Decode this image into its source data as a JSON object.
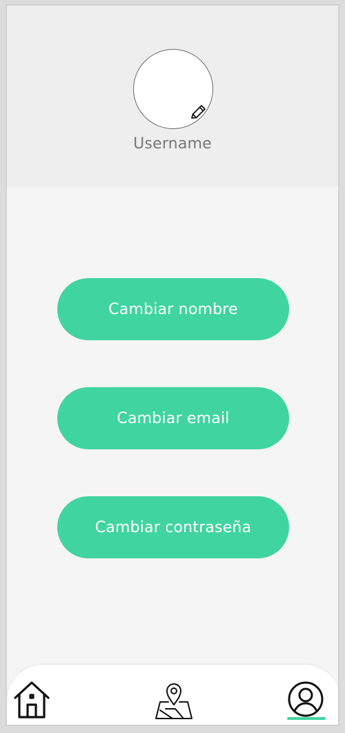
{
  "profile": {
    "username": "Username",
    "avatar_edit_icon": "pencil-icon"
  },
  "actions": {
    "change_name": "Cambiar nombre",
    "change_email": "Cambiar email",
    "change_password": "Cambiar contraseña"
  },
  "nav": {
    "items": [
      {
        "icon": "home-icon"
      },
      {
        "icon": "map-pin-icon"
      },
      {
        "icon": "user-circle-icon"
      }
    ],
    "active_index": 2
  },
  "colors": {
    "accent": "#40d4a0",
    "header_bg": "#eeeeee",
    "page_bg": "#f5f5f5",
    "text_muted": "#777777"
  }
}
